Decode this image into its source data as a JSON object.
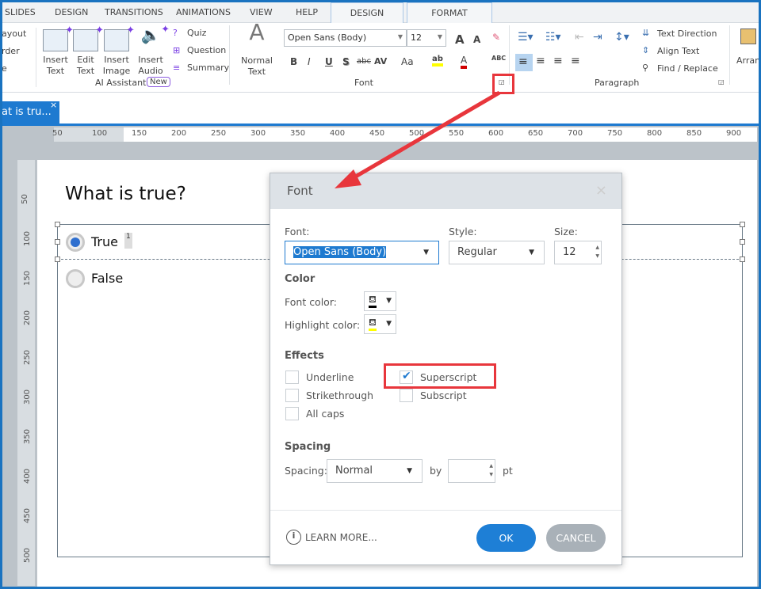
{
  "tabs": [
    "SLIDES",
    "DESIGN",
    "TRANSITIONS",
    "ANIMATIONS",
    "VIEW",
    "HELP"
  ],
  "context_tabs": [
    "DESIGN",
    "FORMAT"
  ],
  "ribbon": {
    "left_partial": [
      "ayout",
      "rder",
      "e"
    ],
    "ai_buttons": [
      {
        "l1": "Insert",
        "l2": "Text"
      },
      {
        "l1": "Edit",
        "l2": "Text"
      },
      {
        "l1": "Insert",
        "l2": "Image"
      },
      {
        "l1": "Insert",
        "l2": "Audio"
      }
    ],
    "ai_small": [
      "Quiz",
      "Question",
      "Summary"
    ],
    "ai_group": "AI Assistant",
    "ai_badge": "New",
    "normal_text": {
      "l1": "Normal",
      "l2": "Text"
    },
    "font_name": "Open Sans (Body)",
    "font_size": "12",
    "font_buttons": [
      "B",
      "I",
      "U",
      "S",
      "abc",
      "AV",
      "Aa"
    ],
    "font_group": "Font",
    "spell": "ABC",
    "para_group": "Paragraph",
    "para_items": [
      "Text Direction",
      "Align Text",
      "Find / Replace"
    ],
    "arrange": "Arran"
  },
  "doc_tab": {
    "title": "at is tru..."
  },
  "ruler_h": [
    "50",
    "100",
    "150",
    "200",
    "250",
    "300",
    "350",
    "400",
    "450",
    "500",
    "550",
    "600",
    "650",
    "700",
    "750",
    "800",
    "850",
    "900"
  ],
  "ruler_v": [
    "50",
    "100",
    "150",
    "200",
    "250",
    "300",
    "350",
    "400",
    "450",
    "500"
  ],
  "slide": {
    "question": "What is true?",
    "options": [
      {
        "label": "True",
        "selected": true,
        "sup": "1"
      },
      {
        "label": "False",
        "selected": false
      }
    ]
  },
  "dialog": {
    "title": "Font",
    "close": "×",
    "font_label": "Font:",
    "font_value": "Open Sans (Body)",
    "style_label": "Style:",
    "style_value": "Regular",
    "size_label": "Size:",
    "size_value": "12",
    "color_section": "Color",
    "font_color_label": "Font color:",
    "highlight_label": "Highlight color:",
    "font_color": "#000000",
    "highlight_color": "#ffff00",
    "effects_section": "Effects",
    "effects": [
      {
        "label": "Underline",
        "checked": false
      },
      {
        "label": "Strikethrough",
        "checked": false
      },
      {
        "label": "All caps",
        "checked": false
      },
      {
        "label": "Superscript",
        "checked": true
      },
      {
        "label": "Subscript",
        "checked": false
      }
    ],
    "spacing_section": "Spacing",
    "spacing_label": "Spacing:",
    "spacing_value": "Normal",
    "by_label": "by",
    "pt_value": "",
    "pt_label": "pt",
    "learn_more": "LEARN MORE...",
    "ok": "OK",
    "cancel": "CANCEL"
  },
  "colors": {
    "accent": "#1e7ad0",
    "annotation": "#e8363c",
    "ok": "#1e7fd6",
    "cancel": "#a9b1b8"
  }
}
